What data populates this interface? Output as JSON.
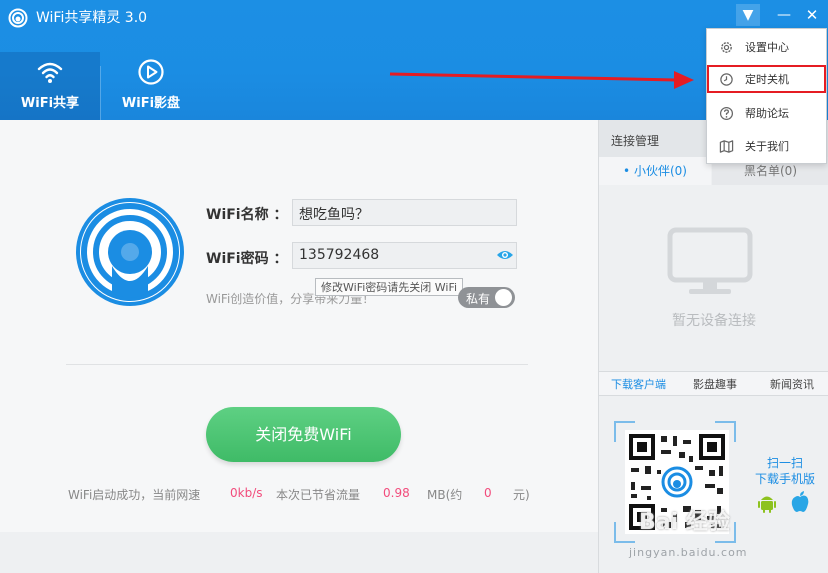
{
  "app": {
    "title": "WiFi共享精灵 3.0"
  },
  "window_controls": {
    "menu": "▼",
    "minimize": "—",
    "close": "✕"
  },
  "nav": {
    "tabs": [
      {
        "label": "WiFi共享",
        "icon": "wifi-icon"
      },
      {
        "label": "WiFi影盘",
        "icon": "play-circle-icon"
      }
    ]
  },
  "form": {
    "name_label": "WiFi名称 ：",
    "name_value": "想吃鱼吗？",
    "password_label": "WiFi密码 ：",
    "password_value": "135792468",
    "tooltip": "修改WiFi密码请先关闭 WiFi",
    "create_text": "WiFi创造价值，分享带来力量！",
    "toggle_label": "私有"
  },
  "action": {
    "button_label": "关闭免费WiFi"
  },
  "status": {
    "prefix": "WiFi启动成功，当前网速",
    "speed": "0kb/s",
    "saved_label": "本次已节省流量",
    "saved_value": "0.98",
    "saved_unit": "MB(约",
    "yuan_value": "0",
    "yuan_unit": "元)"
  },
  "connections": {
    "title": "连接管理",
    "tab_friends": "• 小伙伴(0)",
    "tab_blacklist": "黑名单(0)",
    "empty_text": "暂无设备连接"
  },
  "download": {
    "tabs": [
      "下载客户端",
      "影盘趣事",
      "新闻资讯"
    ],
    "scan_line1": "扫一扫",
    "scan_line2": "下载手机版"
  },
  "watermark": {
    "text": "jingyan.baidu.com",
    "big": "Bai 经验"
  },
  "dropdown": {
    "items": [
      {
        "label": "设置中心",
        "icon": "gear-icon"
      },
      {
        "label": "定时关机",
        "icon": "clock-icon",
        "highlighted": true
      },
      {
        "label": "帮助论坛",
        "icon": "help-icon"
      },
      {
        "label": "关于我们",
        "icon": "map-icon"
      }
    ]
  },
  "colors": {
    "brand": "#1b8de3",
    "button": "#3fbb67",
    "accent": "#f24c7c",
    "annotation": "#e51c23"
  }
}
